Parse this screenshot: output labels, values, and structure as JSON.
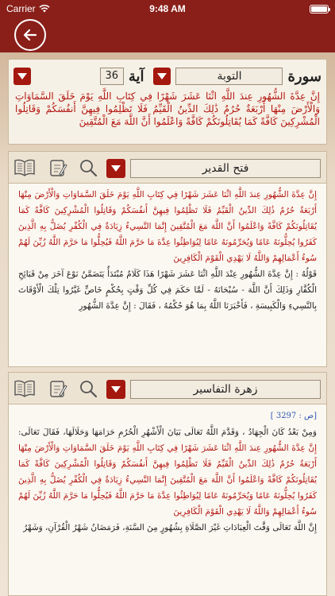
{
  "status": {
    "carrier": "Carrier",
    "time": "9:48 AM"
  },
  "selector": {
    "sura_label": "سورة",
    "sura_value": "التوبة",
    "aya_label": "آية",
    "aya_value": "36"
  },
  "verse_text": "إِنَّ عِدَّةَ الشُّهُورِ عِندَ اللَّهِ اثْنَا عَشَرَ شَهْرًا فِي كِتَابِ اللَّهِ يَوْمَ خَلَقَ السَّمَاوَاتِ وَالْأَرْضَ مِنْهَا أَرْبَعَةٌ حُرُمٌ ذَٰلِكَ الدِّينُ الْقَيِّمُ فَلَا تَظْلِمُوا فِيهِنَّ أَنفُسَكُمْ وَقَاتِلُوا الْمُشْرِكِينَ كَافَّةً كَمَا يُقَاتِلُونَكُمْ كَافَّةً وَاعْلَمُوا أَنَّ اللَّهَ مَعَ الْمُتَّقِينَ",
  "tafsir1": {
    "title": "فتح القدير",
    "verses": "إِنَّ عِدَّةَ الشُّهُورِ عِندَ اللَّهِ اثْنَا عَشَرَ شَهْرًا فِي كِتَابِ اللَّهِ يَوْمَ خَلَقَ السَّمَاوَاتِ وَالْأَرْضَ مِنْهَا أَرْبَعَةٌ حُرُمٌ ذَٰلِكَ الدِّينُ الْقَيِّمُ فَلَا تَظْلِمُوا فِيهِنَّ أَنفُسَكُمْ وَقَاتِلُوا الْمُشْرِكِينَ كَافَّةً كَمَا يُقَاتِلُونَكُمْ كَافَّةً وَاعْلَمُوا أَنَّ اللَّهَ مَعَ الْمُتَّقِينَ إِنَّمَا النَّسِيءُ زِيَادَةٌ فِي الْكُفْرِ يُضَلُّ بِهِ الَّذِينَ كَفَرُوا يُحِلُّونَهُ عَامًا وَيُحَرِّمُونَهُ عَامًا لِيُوَاطِئُوا عِدَّةَ مَا حَرَّمَ اللَّهُ فَيُحِلُّوا مَا حَرَّمَ اللَّهُ زُيِّنَ لَهُمْ سُوءُ أَعْمَالِهِمْ وَاللَّهُ لَا يَهْدِي الْقَوْمَ الْكَافِرِينَ",
    "commentary": "قَوْلُهُ : إِنَّ عِدَّةَ الشُّهُورِ عِنْدَ اللَّهِ اثْنَا عَشَرَ شَهْرًا هَذَا كَلَامٌ مُبْتَدَأٌ يَتَضَمَّنُ نَوْعَ آخَرَ مِنْ قَبَائِحِ الْكُفَّارِ وَذَلِكَ أَنَّ اللَّهَ - سُبْحَانَهُ - لَمَّا حَكَمَ فِي كُلِّ وَقْتٍ بِحُكْمٍ خَاصٍّ غَيَّرُوا تِلْكَ الْأَوْقَاتَ بِالنَّسِيءِ وَالْكَبِيسَةِ ، فَأَخْبَرَنَا اللَّهُ بِمَا هُوَ حُكْمُهُ ، فَقَالَ : إِنَّ عِدَّةَ الشُّهُورِ"
  },
  "tafsir2": {
    "title": "زهرة التفاسير",
    "page_ref": "[ص : 3297 ]",
    "intro": "وَمِنْ بَعْدُ كَانَ الْجِهَادُ ، وَقَدَّمَ اللَّهُ تَعَالَى بَيَانَ الْأَشْهُرِ الْحُرُمِ حَرَامَهَا وَحَلَالَهَا، فَقَالَ تَعَالَى:",
    "verses": "إِنَّ عِدَّةَ الشُّهُورِ عِندَ اللَّهِ اثْنَا عَشَرَ شَهْرًا فِي كِتَابِ اللَّهِ يَوْمَ خَلَقَ السَّمَاوَاتِ وَالْأَرْضَ مِنْهَا أَرْبَعَةٌ حُرُمٌ ذَٰلِكَ الدِّينُ الْقَيِّمُ فَلَا تَظْلِمُوا فِيهِنَّ أَنفُسَكُمْ وَقَاتِلُوا الْمُشْرِكِينَ كَافَّةً كَمَا يُقَاتِلُونَكُمْ كَافَّةً وَاعْلَمُوا أَنَّ اللَّهَ مَعَ الْمُتَّقِينَ إِنَّمَا النَّسِيءُ زِيَادَةٌ فِي الْكُفْرِ يُضَلُّ بِهِ الَّذِينَ كَفَرُوا يُحِلُّونَهُ عَامًا وَيُحَرِّمُونَهُ عَامًا لِيُوَاطِئُوا عِدَّةَ مَا حَرَّمَ اللَّهُ فَيُحِلُّوا مَا حَرَّمَ اللَّهُ زُيِّنَ لَهُمْ سُوءُ أَعْمَالِهِمْ وَاللَّهُ لَا يَهْدِي الْقَوْمَ الْكَافِرِينَ",
    "commentary": "إِنَّ اللَّهَ تَعَالَى وَقَّتَ الْعِبَادَاتِ غَيْرَ الصَّلَاةِ بِشُهُورٍ مِنَ السَّنَةِ، فَرَمَضَانُ شَهْرُ الْقُرْآنِ، وَشَهْرُ"
  }
}
